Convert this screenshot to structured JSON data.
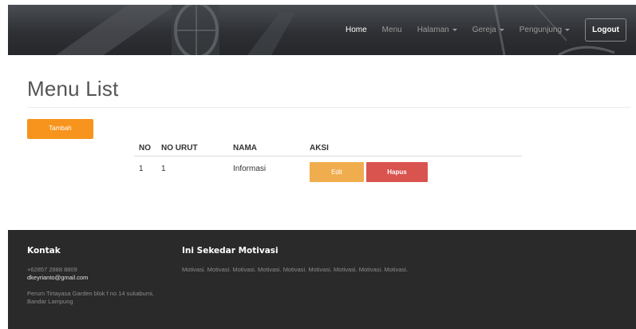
{
  "nav": {
    "items": [
      {
        "label": "Home",
        "active": true,
        "dropdown": false
      },
      {
        "label": "Menu",
        "active": false,
        "dropdown": false
      },
      {
        "label": "Halaman",
        "active": false,
        "dropdown": true
      },
      {
        "label": "Gereja",
        "active": false,
        "dropdown": true
      },
      {
        "label": "Pengunjung",
        "active": false,
        "dropdown": true
      }
    ],
    "logout_label": "Logout"
  },
  "main": {
    "title": "Menu List",
    "add_button_label": "Tambah",
    "table": {
      "headers": [
        "NO",
        "NO URUT",
        "NAMA",
        "AKSI"
      ],
      "rows": [
        {
          "no": "1",
          "no_urut": "1",
          "nama": "Informasi"
        }
      ],
      "edit_label": "Edit",
      "delete_label": "Hapus"
    }
  },
  "footer": {
    "contact": {
      "heading": "Kontak",
      "phone": "+62857 2888 8809",
      "email": "dkeyrianto@gmail.com",
      "address_line1": "Perum Tirtayasa Garden blok f no 14 sukabumi,",
      "address_line2": "Bandar Lampung"
    },
    "motivation": {
      "heading": "Ini Sekedar Motivasi",
      "text": "Motivasi. Motivasi. Motivasi. Motivasi. Motivasi. Motivasi. Motivasi. Motivasi. Motivasi."
    }
  },
  "colors": {
    "accent_orange": "#f7941d",
    "edit_button": "#f0ad4e",
    "delete_button": "#d9534f",
    "footer_bg": "#2a2a2a"
  }
}
